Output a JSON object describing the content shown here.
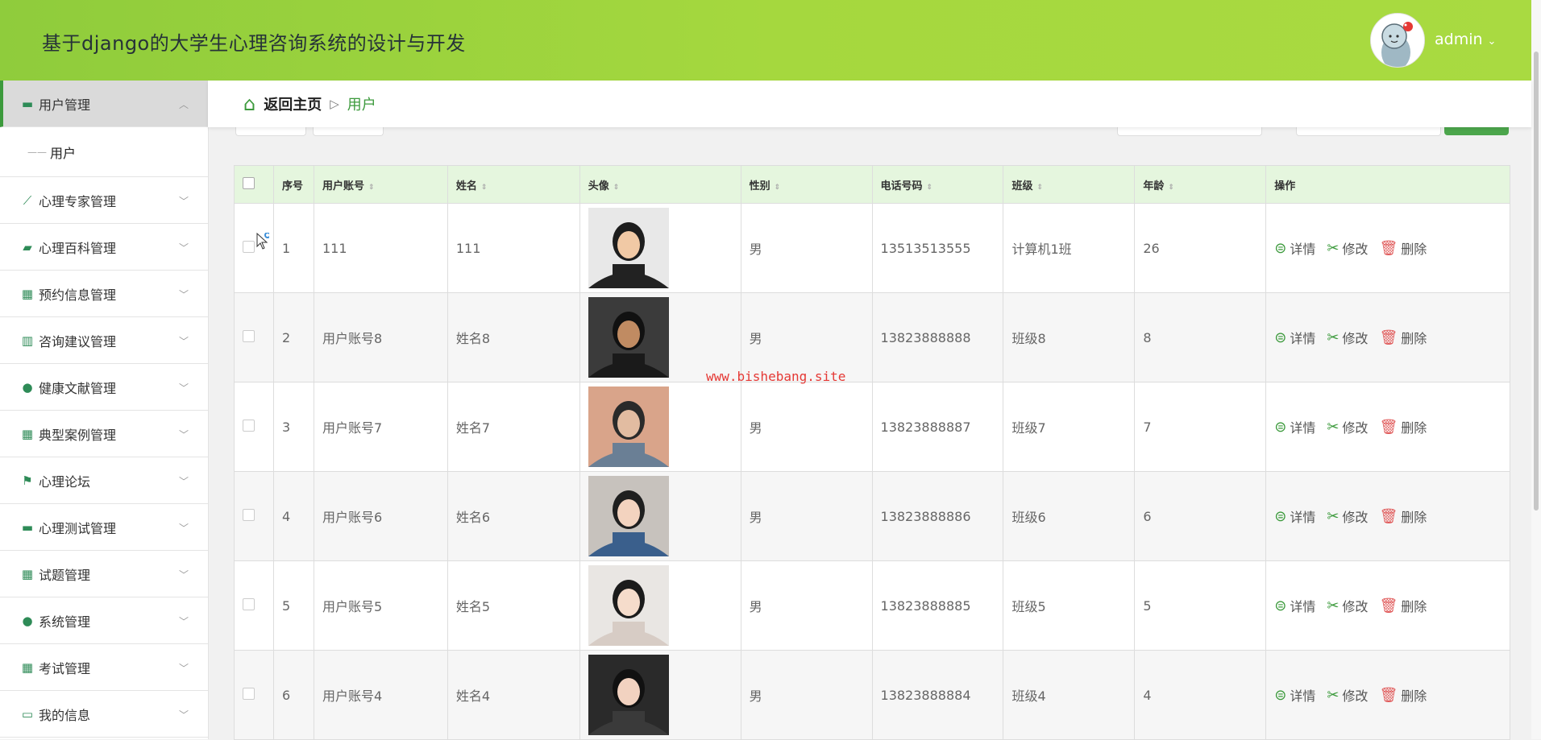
{
  "header": {
    "title": "基于django的大学生心理咨询系统的设计与开发",
    "user_name": "admin"
  },
  "sidebar": {
    "items": [
      {
        "label": "用户管理",
        "icon": "monitor-icon",
        "active": true
      },
      {
        "label": "心理专家管理",
        "icon": "chart-icon"
      },
      {
        "label": "心理百科管理",
        "icon": "wallet-icon"
      },
      {
        "label": "预约信息管理",
        "icon": "grid-icon"
      },
      {
        "label": "咨询建议管理",
        "icon": "book-icon"
      },
      {
        "label": "健康文献管理",
        "icon": "leaf-icon"
      },
      {
        "label": "典型案例管理",
        "icon": "apps-icon"
      },
      {
        "label": "心理论坛",
        "icon": "flag-icon"
      },
      {
        "label": "心理测试管理",
        "icon": "monitor-icon"
      },
      {
        "label": "试题管理",
        "icon": "grid-icon"
      },
      {
        "label": "系统管理",
        "icon": "user-icon"
      },
      {
        "label": "考试管理",
        "icon": "grid-icon"
      },
      {
        "label": "我的信息",
        "icon": "id-card-icon"
      }
    ],
    "submenu": {
      "label": "用户"
    }
  },
  "breadcrumb": {
    "home": "返回主页",
    "current": "用户"
  },
  "table": {
    "headers": [
      "序号",
      "用户账号",
      "姓名",
      "头像",
      "性别",
      "电话号码",
      "班级",
      "年龄",
      "操作"
    ],
    "actions": {
      "detail": "详情",
      "edit": "修改",
      "delete": "删除"
    },
    "rows": [
      {
        "index": "1",
        "account": "111",
        "name": "111",
        "gender": "男",
        "phone": "13513513555",
        "class": "计算机1班",
        "age": "26"
      },
      {
        "index": "2",
        "account": "用户账号8",
        "name": "姓名8",
        "gender": "男",
        "phone": "13823888888",
        "class": "班级8",
        "age": "8"
      },
      {
        "index": "3",
        "account": "用户账号7",
        "name": "姓名7",
        "gender": "男",
        "phone": "13823888887",
        "class": "班级7",
        "age": "7"
      },
      {
        "index": "4",
        "account": "用户账号6",
        "name": "姓名6",
        "gender": "男",
        "phone": "13823888886",
        "class": "班级6",
        "age": "6"
      },
      {
        "index": "5",
        "account": "用户账号5",
        "name": "姓名5",
        "gender": "男",
        "phone": "13823888885",
        "class": "班级5",
        "age": "5"
      },
      {
        "index": "6",
        "account": "用户账号4",
        "name": "姓名4",
        "gender": "男",
        "phone": "13823888884",
        "class": "班级4",
        "age": "4"
      }
    ]
  },
  "watermark": "www.bishebang.site",
  "colors": {
    "header_start": "#8fcc3c",
    "header_end": "#a9da41",
    "accent": "#3c9a3c",
    "table_head": "#e5f6de",
    "delete": "#e05a5a"
  }
}
